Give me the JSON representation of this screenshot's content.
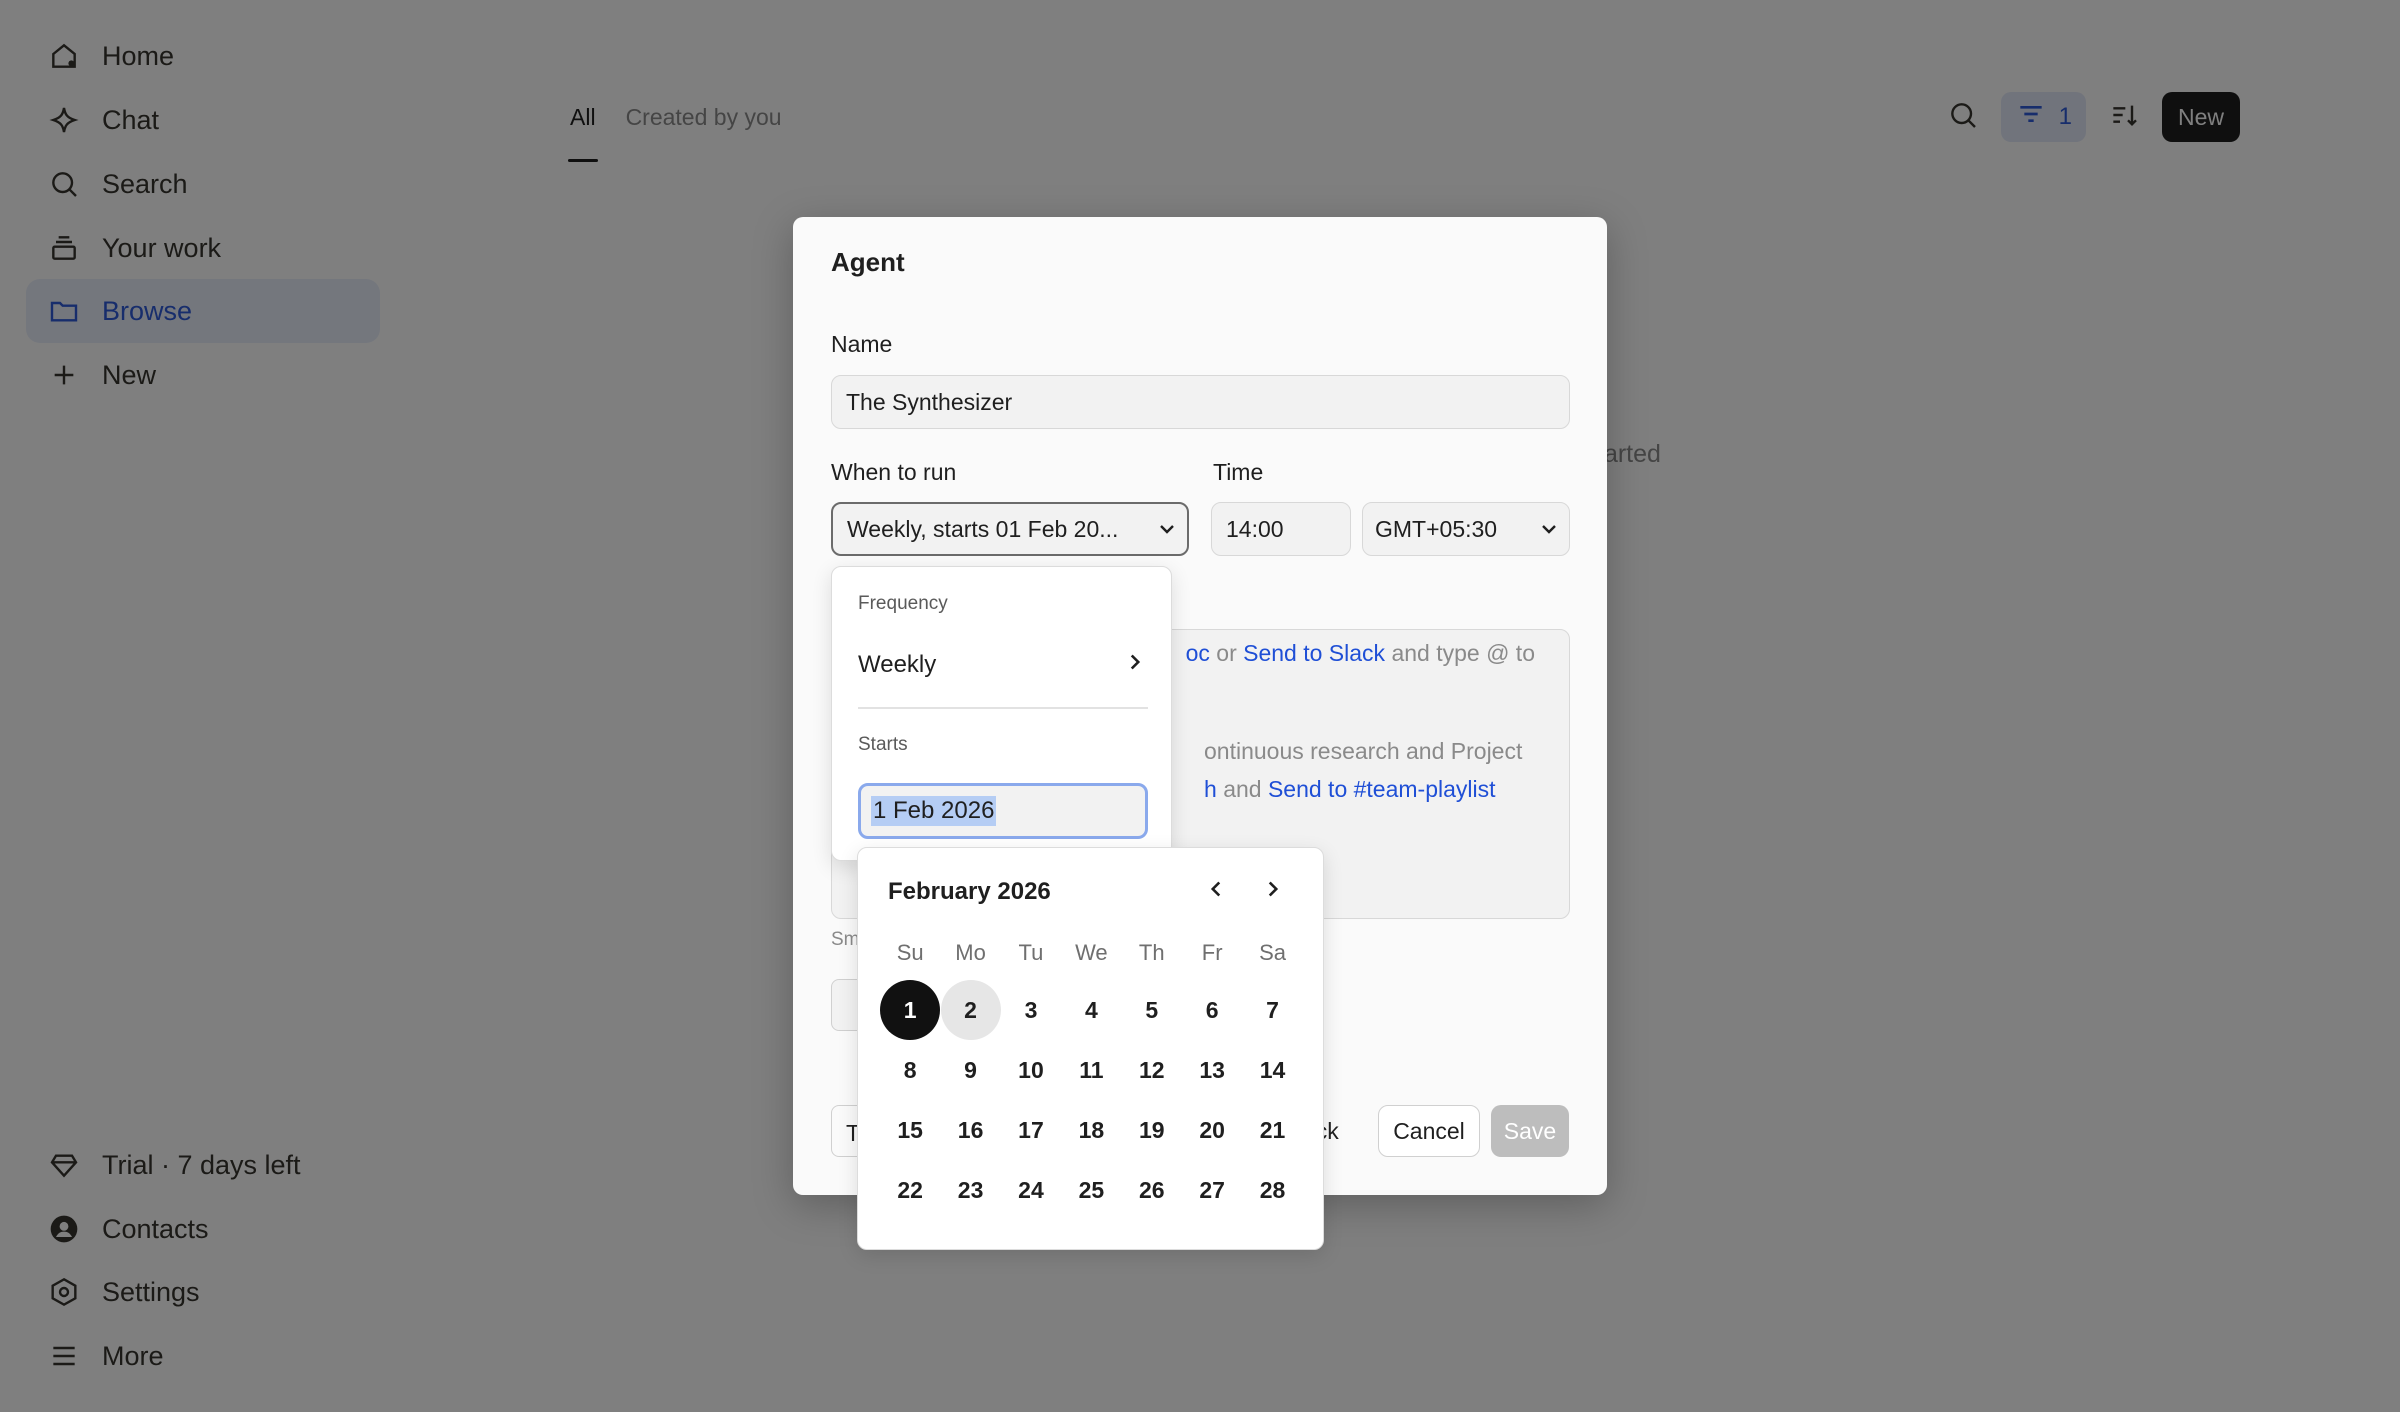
{
  "sidebar": {
    "items": [
      {
        "label": "Home",
        "icon": "home-icon"
      },
      {
        "label": "Chat",
        "icon": "sparkle-icon"
      },
      {
        "label": "Search",
        "icon": "search-icon"
      },
      {
        "label": "Your work",
        "icon": "stack-icon"
      },
      {
        "label": "Browse",
        "icon": "folder-icon",
        "active": true
      },
      {
        "label": "New",
        "icon": "plus-icon"
      }
    ],
    "bottom": [
      {
        "label": "Trial · 7 days left",
        "icon": "gem-icon"
      },
      {
        "label": "Contacts",
        "icon": "person-circle-icon"
      },
      {
        "label": "Settings",
        "icon": "hexagon-gear-icon"
      },
      {
        "label": "More",
        "icon": "menu-icon"
      }
    ]
  },
  "tabs": [
    {
      "label": "All",
      "active": true
    },
    {
      "label": "Created by you"
    }
  ],
  "toolbar": {
    "filter_count": "1",
    "new_label": "New"
  },
  "background_hint": "tarted",
  "dialog": {
    "title": "Agent",
    "name_label": "Name",
    "name_value": "The Synthesizer",
    "when_label": "When to run",
    "when_value": "Weekly, starts 01 Feb 20...",
    "time_label": "Time",
    "time_value": "14:00",
    "timezone_value": "GMT+05:30",
    "instructions": {
      "line1_prefix": "oc",
      "line1_or": "or",
      "line1_link": "Send to Slack",
      "line1_suffix": "and type @ to",
      "line2": "ontinuous research and Project",
      "line3_link1": "h",
      "line3_and": "and",
      "line3_link2": "Send to #team-playlist"
    },
    "small_text": "Sm",
    "left_button": "T",
    "back_label": "ack",
    "cancel_label": "Cancel",
    "save_label": "Save"
  },
  "frequency_popover": {
    "frequency_label": "Frequency",
    "frequency_value": "Weekly",
    "starts_label": "Starts",
    "starts_value": "1 Feb 2026"
  },
  "calendar": {
    "month_label": "February 2026",
    "weekdays": [
      "Su",
      "Mo",
      "Tu",
      "We",
      "Th",
      "Fr",
      "Sa"
    ],
    "days": [
      "1",
      "2",
      "3",
      "4",
      "5",
      "6",
      "7",
      "8",
      "9",
      "10",
      "11",
      "12",
      "13",
      "14",
      "15",
      "16",
      "17",
      "18",
      "19",
      "20",
      "21",
      "22",
      "23",
      "24",
      "25",
      "26",
      "27",
      "28"
    ],
    "selected_day": "1",
    "hovered_day": "2"
  },
  "colors": {
    "accent": "#2e5bd8",
    "link": "#1f4fd6",
    "selected_day_bg": "#111111",
    "overlay": "rgba(0,0,0,0.5)"
  }
}
